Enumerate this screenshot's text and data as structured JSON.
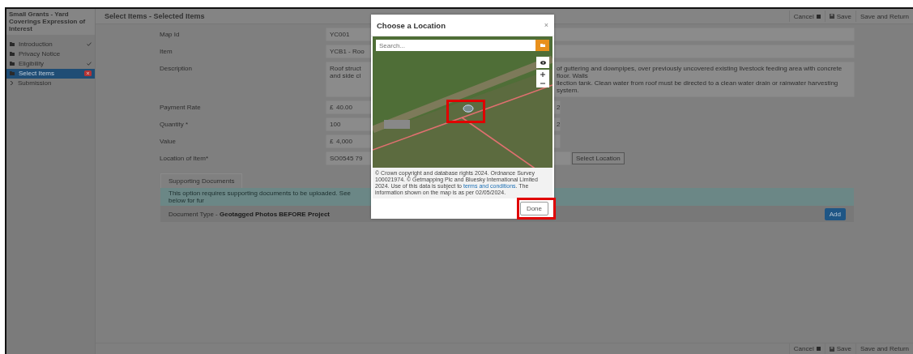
{
  "app": {
    "title": "Small Grants - Yard Coverings Expression of Interest"
  },
  "sidebar": {
    "items": [
      {
        "label": "Introduction",
        "kind": "folder",
        "complete": true,
        "selected": false,
        "error": false
      },
      {
        "label": "Privacy Notice",
        "kind": "folder",
        "complete": false,
        "selected": false,
        "error": false
      },
      {
        "label": "Eligibility",
        "kind": "folder",
        "complete": true,
        "selected": false,
        "error": false
      },
      {
        "label": "Select Items",
        "kind": "folder",
        "complete": false,
        "selected": true,
        "error": true
      },
      {
        "label": "Submission",
        "kind": "arrow",
        "complete": false,
        "selected": false,
        "error": false
      }
    ]
  },
  "header": {
    "title": "Select Items - Selected Items",
    "actions": [
      {
        "label": "Cancel",
        "kind": "cancel"
      },
      {
        "label": "Save",
        "kind": "save"
      },
      {
        "label": "Save and Return",
        "kind": "plain"
      }
    ]
  },
  "form": {
    "fields": [
      {
        "label": "Map Id",
        "kind": "wide",
        "before": [
          "YC001"
        ]
      },
      {
        "label": "Item",
        "kind": "wide",
        "before": [
          "YCB1 - Roo"
        ]
      },
      {
        "label": "Description",
        "kind": "wide",
        "before": [
          "Roof struct",
          "and side cl"
        ],
        "after": [
          "of guttering and downpipes, over previously uncovered existing livestock feeding area with concrete floor. Walls",
          "llection tank. Clean water from roof must be directed to a clean water drain or rainwater harvesting system."
        ]
      },
      {
        "label": "Payment Rate",
        "kind": "short",
        "prefix": "£",
        "before": [
          "40.00"
        ],
        "after": [
          "2"
        ]
      },
      {
        "label": "Quantity *",
        "kind": "short",
        "before": [
          "100"
        ],
        "after": [
          "2"
        ]
      },
      {
        "label": "Value",
        "kind": "short",
        "prefix": "£",
        "before": [
          "4,000"
        ]
      },
      {
        "label": "Location of Item*",
        "kind": "location",
        "before": [
          "SO0545 79"
        ],
        "button": "Select Location"
      }
    ]
  },
  "documents": {
    "tab": "Supporting Documents",
    "info": "This option requires supporting documents to be uploaded. See below for fur",
    "row": "Document Type - **Geotagged Photos BEFORE Project**",
    "button": "Add"
  },
  "footer": {
    "actions": [
      {
        "label": "Cancel",
        "kind": "cancel"
      },
      {
        "label": "Save",
        "kind": "save"
      },
      {
        "label": "Save and Return",
        "kind": "plain"
      }
    ]
  },
  "modal": {
    "title": "Choose a Location",
    "close": "×",
    "search": {
      "placeholder": "Search..."
    },
    "map": {
      "marker_highlighted": true
    },
    "attribution": "© Crown copyright and database rights 2024. Ordnance Survey 100021974. © Getmapping Plc and Bluesky International Limited 2024. Use of this data is subject to ",
    "link": "terms and conditions",
    "attribution_end": ". The information shown on the map is as per 02/05/2024.",
    "done": {
      "label": "Done",
      "highlighted": true
    }
  }
}
